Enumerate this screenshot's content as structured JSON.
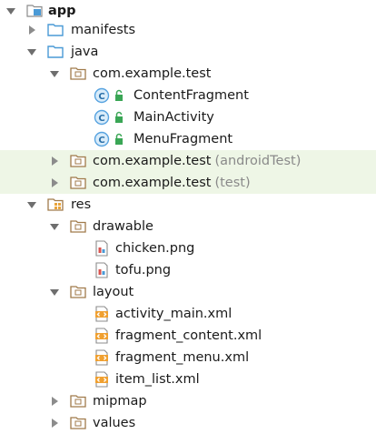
{
  "tree": {
    "app": {
      "label": "app"
    },
    "manifests": {
      "label": "manifests"
    },
    "java": {
      "label": "java"
    },
    "pkg_main": {
      "label": "com.example.test"
    },
    "content_fragment": {
      "label": "ContentFragment"
    },
    "main_activity": {
      "label": "MainActivity"
    },
    "menu_fragment": {
      "label": "MenuFragment"
    },
    "pkg_android_test": {
      "label": "com.example.test",
      "suffix": "(androidTest)"
    },
    "pkg_test": {
      "label": "com.example.test",
      "suffix": "(test)"
    },
    "res": {
      "label": "res"
    },
    "drawable": {
      "label": "drawable"
    },
    "chicken": {
      "label": "chicken.png"
    },
    "tofu": {
      "label": "tofu.png"
    },
    "layout": {
      "label": "layout"
    },
    "activity_main": {
      "label": "activity_main.xml"
    },
    "fragment_content": {
      "label": "fragment_content.xml"
    },
    "fragment_menu": {
      "label": "fragment_menu.xml"
    },
    "item_list": {
      "label": "item_list.xml"
    },
    "mipmap": {
      "label": "mipmap"
    },
    "values": {
      "label": "values"
    }
  },
  "colors": {
    "selected_row_bg": "#eef6e6",
    "suffix_text": "#8a8a8a",
    "folder_blue": "#4a9ad6",
    "package_brown": "#a07a4a",
    "class_circle": "#57a3e0",
    "xml_orange": "#f0a030"
  }
}
